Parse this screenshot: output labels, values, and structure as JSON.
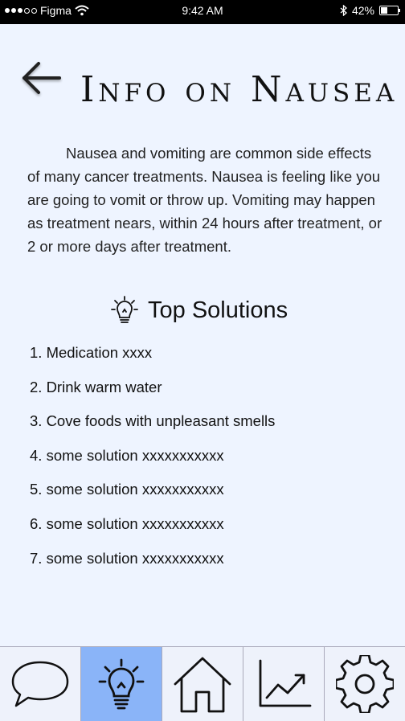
{
  "status_bar": {
    "carrier": "Figma",
    "time": "9:42 AM",
    "battery_percent": "42%",
    "battery_level": 0.42,
    "icons": [
      "signal-dots-icon",
      "wifi-icon",
      "bluetooth-icon",
      "battery-icon"
    ]
  },
  "header": {
    "back_icon": "arrow-left-icon",
    "title": "Info on Nausea"
  },
  "intro_text": "Nausea and vomiting are common side effects of many cancer treatments. Nausea is feeling like you are going to vomit or throw up. Vomiting may happen as treatment nears, within 24 hours after treatment, or 2 or more days after treatment.",
  "solutions": {
    "icon": "lightbulb-icon",
    "title": "Top Solutions",
    "items": [
      "1. Medication xxxx",
      "2. Drink warm water",
      "3. Cove foods with unpleasant smells",
      "4. some solution xxxxxxxxxxx",
      "5. some solution xxxxxxxxxxx",
      "6. some solution xxxxxxxxxxx",
      "7. some solution xxxxxxxxxxx"
    ]
  },
  "tab_bar": {
    "active": "solutions",
    "tabs": [
      {
        "id": "chat",
        "icon": "speech-bubble-icon"
      },
      {
        "id": "solutions",
        "icon": "lightbulb-icon"
      },
      {
        "id": "home",
        "icon": "home-icon"
      },
      {
        "id": "progress",
        "icon": "trend-chart-icon"
      },
      {
        "id": "settings",
        "icon": "gear-icon"
      }
    ]
  },
  "colors": {
    "background": "#eef4ff",
    "status_bar": "#000000",
    "active_tab": "#8ab4f8"
  }
}
